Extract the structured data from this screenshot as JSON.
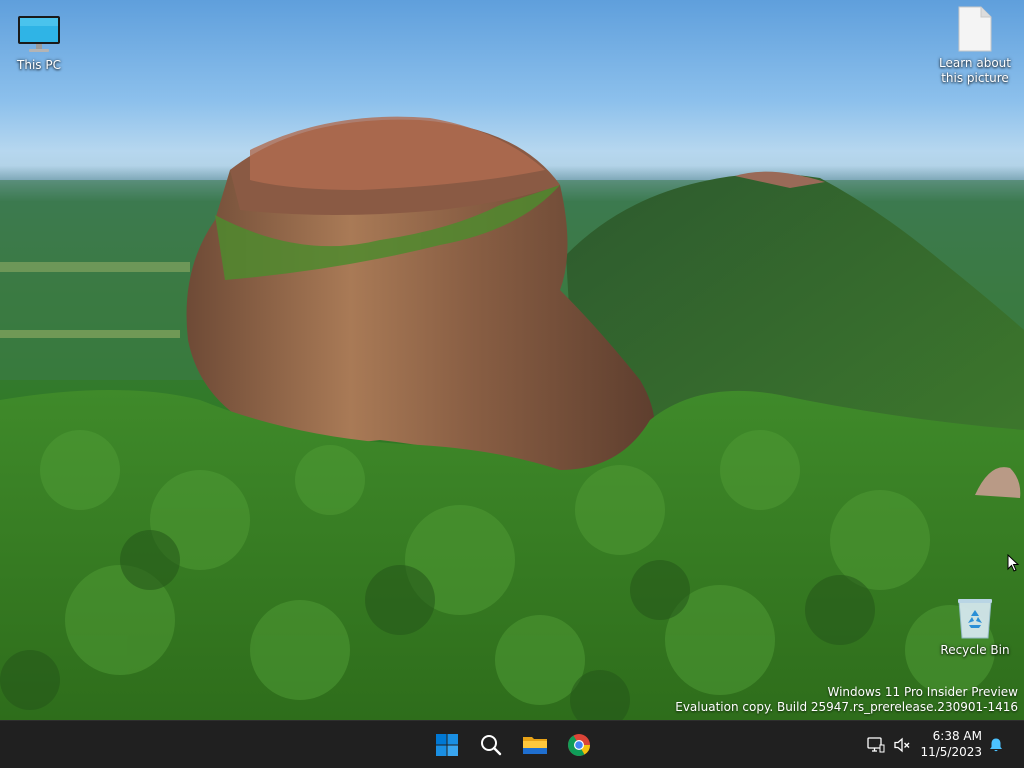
{
  "desktop": {
    "icons": [
      {
        "label": "This PC",
        "icon": "monitor-icon"
      },
      {
        "label_line1": "Learn about",
        "label_line2": "this picture",
        "icon": "document-icon"
      },
      {
        "label": "Recycle Bin",
        "icon": "recycle-bin-icon"
      }
    ],
    "watermark": {
      "line1": "Windows 11 Pro Insider Preview",
      "line2": "Evaluation copy. Build 25947.rs_prerelease.230901-1416"
    }
  },
  "taskbar": {
    "apps": [
      {
        "name": "Start",
        "icon": "windows-start-icon"
      },
      {
        "name": "Search",
        "icon": "search-icon"
      },
      {
        "name": "File Explorer",
        "icon": "folder-icon"
      },
      {
        "name": "Google Chrome",
        "icon": "chrome-icon"
      }
    ],
    "tray": {
      "network_icon": "network-icon",
      "volume_icon": "volume-muted-icon",
      "notification_icon": "bell-icon"
    },
    "clock": {
      "time": "6:38 AM",
      "date": "11/5/2023"
    }
  },
  "colors": {
    "taskbar_bg": "#202020",
    "start_blue": "#0078d4",
    "notification_blue": "#4cc2ff"
  }
}
